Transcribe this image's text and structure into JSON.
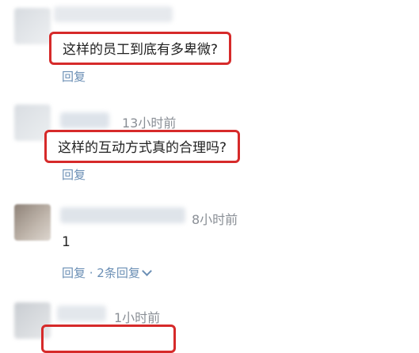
{
  "comments": [
    {
      "text": "这样的员工到底有多卑微?",
      "reply": "回复"
    },
    {
      "time": "13小时前",
      "text": "这样的互动方式真的合理吗?",
      "reply": "回复"
    },
    {
      "time": "8小时前",
      "text": "1",
      "reply": "回复 · 2条回复"
    },
    {
      "time": "1小时前"
    }
  ]
}
